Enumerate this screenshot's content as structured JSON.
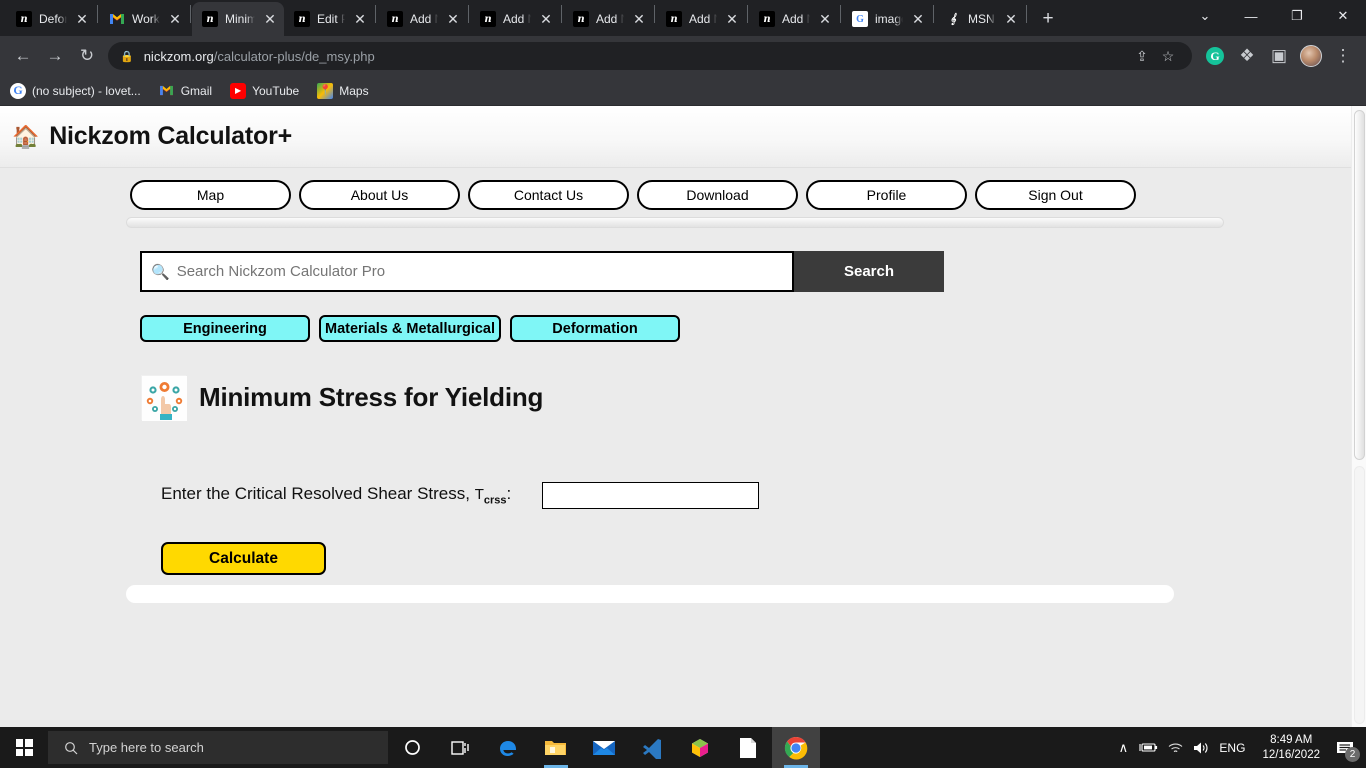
{
  "browser": {
    "tabs": [
      {
        "title": "Deform",
        "icon": "nickzom-favicon",
        "active": false
      },
      {
        "title": "Workl",
        "icon": "gmail-favicon",
        "active": false
      },
      {
        "title": "Minim",
        "icon": "nickzom-favicon",
        "active": true
      },
      {
        "title": "Edit Po",
        "icon": "nickzom-favicon",
        "active": false
      },
      {
        "title": "Add N",
        "icon": "nickzom-favicon",
        "active": false
      },
      {
        "title": "Add N",
        "icon": "nickzom-favicon",
        "active": false
      },
      {
        "title": "Add N",
        "icon": "nickzom-favicon",
        "active": false
      },
      {
        "title": "Add N",
        "icon": "nickzom-favicon",
        "active": false
      },
      {
        "title": "Add N",
        "icon": "nickzom-favicon",
        "active": false
      },
      {
        "title": "image",
        "icon": "google-favicon",
        "active": false
      },
      {
        "title": "MSN ",
        "icon": "msn-favicon",
        "active": false
      }
    ],
    "new_tab_label": "+",
    "window_controls": {
      "minimize": "—",
      "maximize": "❐",
      "close": "✕"
    },
    "nav": {
      "back": "←",
      "forward": "→",
      "reload": "↻"
    },
    "omnibox": {
      "lock": "🔒",
      "domain": "nickzom.org",
      "path": "/calculator-plus/de_msy.php",
      "share_icon": "share-icon",
      "bookmark_icon": "star-icon"
    },
    "extensions": {
      "grammarly": "G",
      "puzzle": "❖",
      "sidepanel": "▣",
      "menu": "⋮"
    },
    "bookmarks": [
      {
        "label": "(no subject) - lovet...",
        "icon": "google-icon"
      },
      {
        "label": "Gmail",
        "icon": "gmail-icon"
      },
      {
        "label": "YouTube",
        "icon": "youtube-icon"
      },
      {
        "label": "Maps",
        "icon": "maps-icon"
      }
    ]
  },
  "page": {
    "header": {
      "home_glyph": "🏠",
      "title": "Nickzom Calculator+"
    },
    "nav_buttons": [
      "Map",
      "About Us",
      "Contact Us",
      "Download",
      "Profile",
      "Sign Out"
    ],
    "search": {
      "icon": "🔍",
      "placeholder": "Search Nickzom Calculator Pro",
      "value": "",
      "button_label": "Search"
    },
    "breadcrumbs": [
      "Engineering",
      "Materials & Metallurgical",
      "Deformation"
    ],
    "calculator": {
      "icon": "network-hand-icon",
      "heading": "Minimum Stress for Yielding",
      "field": {
        "label_prefix": "Enter the Critical Resolved Shear Stress, ",
        "symbol": "T",
        "subscript": "crss",
        "label_suffix": ":",
        "value": "",
        "placeholder": ""
      },
      "calculate_label": "Calculate"
    },
    "colors": {
      "breadcrumb_fill": "#7ff6f6",
      "calculate_fill": "#ffd900",
      "search_button_fill": "#3b3b3b",
      "page_background": "#ebebeb"
    }
  },
  "taskbar": {
    "start_label": "Start",
    "search_placeholder": "Type here to search",
    "search_icon": "🔍",
    "items": [
      {
        "name": "cortana-icon",
        "glyph": "○"
      },
      {
        "name": "task-view-icon",
        "glyph": "⧉"
      },
      {
        "name": "edge-icon",
        "glyph": "e"
      },
      {
        "name": "file-explorer-icon",
        "glyph": "📁"
      },
      {
        "name": "mail-icon",
        "glyph": "✉"
      },
      {
        "name": "vscode-icon",
        "glyph": "✕"
      },
      {
        "name": "package-icon",
        "glyph": "⬟"
      },
      {
        "name": "notepad-icon",
        "glyph": "🗎"
      },
      {
        "name": "chrome-icon",
        "glyph": "●"
      }
    ],
    "tray": {
      "chevron": "∧",
      "battery": "🔋",
      "wifi": "📶",
      "volume": "🔊",
      "language": "ENG",
      "time": "8:49 AM",
      "date": "12/16/2022",
      "notification_count": "2"
    }
  }
}
